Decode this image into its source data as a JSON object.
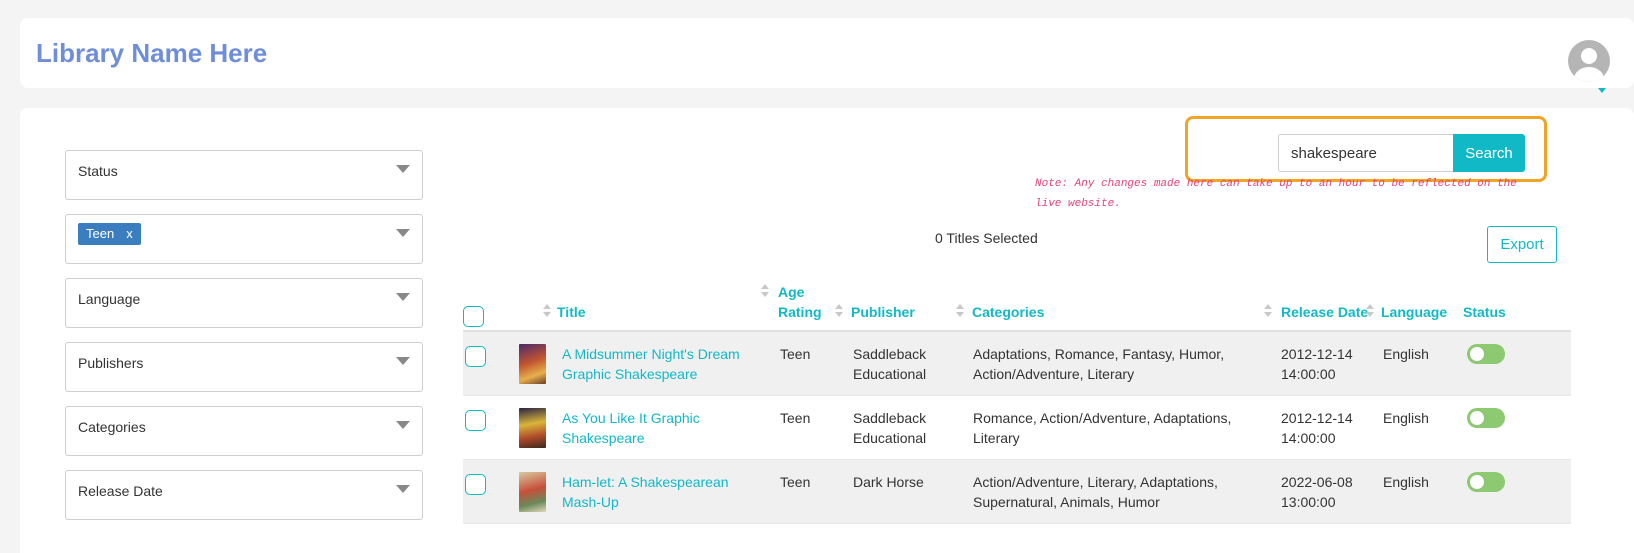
{
  "header": {
    "brand": "Library Name Here"
  },
  "filters": {
    "status": "Status",
    "age_tag": "Teen",
    "age_tag_remove": "x",
    "language": "Language",
    "publishers": "Publishers",
    "categories": "Categories",
    "release_date": "Release Date"
  },
  "search": {
    "value": "shakespeare",
    "button": "Search"
  },
  "note": "Note: Any changes made here can take up to an hour to be reflected on the live website.",
  "selected_count": "0 Titles Selected",
  "export_label": "Export",
  "table": {
    "headers": {
      "title": "Title",
      "age_rating_1": "Age",
      "age_rating_2": "Rating",
      "publisher": "Publisher",
      "categories": "Categories",
      "release_date": "Release Date",
      "language": "Language",
      "status": "Status"
    },
    "rows": [
      {
        "title_1": "A Midsummer Night's Dream",
        "title_2": "Graphic Shakespeare",
        "age": "Teen",
        "publisher_1": "Saddleback",
        "publisher_2": "Educational",
        "categories_1": "Adaptations, Romance, Fantasy, Humor,",
        "categories_2": "Action/Adventure, Literary",
        "date_1": "2012-12-14",
        "date_2": "14:00:00",
        "language": "English",
        "status_on": true
      },
      {
        "title_1": "As You Like It Graphic",
        "title_2": "Shakespeare",
        "age": "Teen",
        "publisher_1": "Saddleback",
        "publisher_2": "Educational",
        "categories_1": "Romance, Action/Adventure, Adaptations,",
        "categories_2": "Literary",
        "date_1": "2012-12-14",
        "date_2": "14:00:00",
        "language": "English",
        "status_on": true
      },
      {
        "title_1": "Ham-let: A Shakespearean",
        "title_2": "Mash-Up",
        "age": "Teen",
        "publisher_1": "Dark Horse",
        "publisher_2": "",
        "categories_1": "Action/Adventure, Literary, Adaptations,",
        "categories_2": "Supernatural, Animals, Humor",
        "date_1": "2022-06-08",
        "date_2": "13:00:00",
        "language": "English",
        "status_on": true
      }
    ]
  },
  "colors": {
    "accent": "#11b9c6",
    "brand": "#6f8ed9",
    "highlight": "#f0a624",
    "toggle_on": "#8dc970",
    "tag": "#3a7ebf",
    "note": "#e0457b"
  }
}
